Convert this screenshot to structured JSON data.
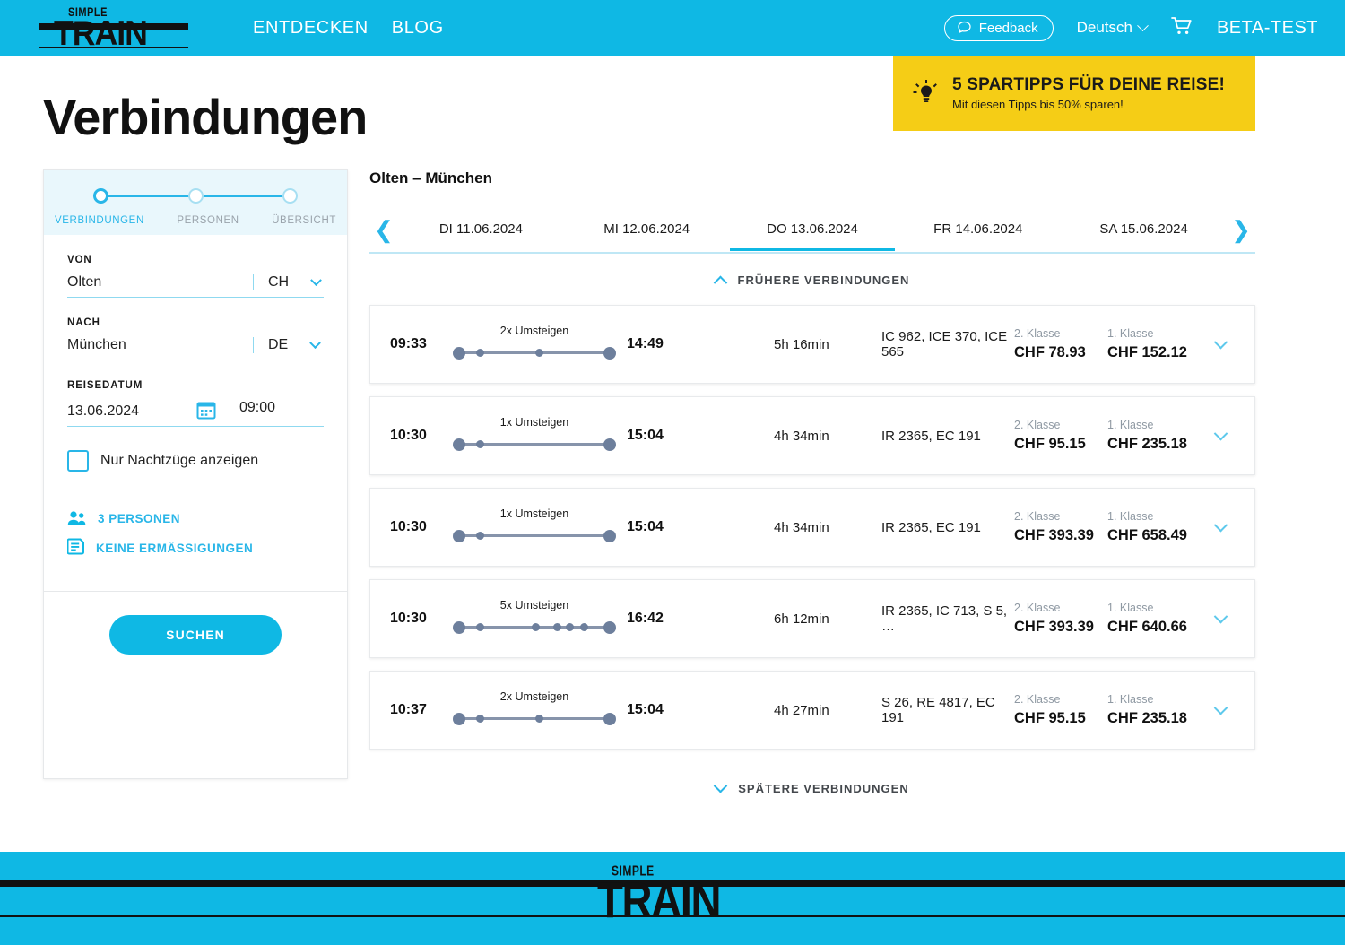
{
  "header": {
    "logo_top": "SIMPLE",
    "logo_main": "TRAIN",
    "nav": [
      {
        "label": "ENTDECKEN"
      },
      {
        "label": "BLOG"
      }
    ],
    "feedback_label": "Feedback",
    "language": "Deutsch",
    "beta_label": "BETA-TEST",
    "brand_color": "#0fb8e4"
  },
  "promo": {
    "title": "5 SPARTIPPS FÜR DEINE REISE!",
    "subtitle": "Mit diesen Tipps bis 50% sparen!",
    "background": "#f5cd16"
  },
  "page_title": "Verbindungen",
  "sidebar": {
    "steps": [
      {
        "label": "VERBINDUNGEN",
        "state": "active"
      },
      {
        "label": "PERSONEN",
        "state": "pending"
      },
      {
        "label": "ÜBERSICHT",
        "state": "pending"
      }
    ],
    "from_label": "VON",
    "from_city": "Olten",
    "from_country": "CH",
    "to_label": "NACH",
    "to_city": "München",
    "to_country": "DE",
    "date_label": "REISEDATUM",
    "date_value": "13.06.2024",
    "time_value": "09:00",
    "night_trains_label": "Nur Nachtzüge anzeigen",
    "night_trains_checked": false,
    "persons_label": "3 PERSONEN",
    "discounts_label": "KEINE ERMÄSSIGUNGEN",
    "search_label": "SUCHEN"
  },
  "results": {
    "route_title": "Olten – München",
    "date_tabs": [
      {
        "label": "DI 11.06.2024",
        "active": false
      },
      {
        "label": "MI 12.06.2024",
        "active": false
      },
      {
        "label": "DO 13.06.2024",
        "active": true
      },
      {
        "label": "FR 14.06.2024",
        "active": false
      },
      {
        "label": "SA 15.06.2024",
        "active": false
      }
    ],
    "earlier_label": "FRÜHERE VERBINDUNGEN",
    "later_label": "SPÄTERE VERBINDUNGEN",
    "class2_label": "2. Klasse",
    "class1_label": "1. Klasse",
    "connections": [
      {
        "departure": "09:33",
        "arrival": "14:49",
        "changes_label": "2x Umsteigen",
        "changes": 2,
        "duration": "5h 16min",
        "trains": "IC 962, ICE 370, ICE 565",
        "price_class2": "CHF 78.93",
        "price_class1": "CHF 152.12"
      },
      {
        "departure": "10:30",
        "arrival": "15:04",
        "changes_label": "1x Umsteigen",
        "changes": 1,
        "duration": "4h 34min",
        "trains": "IR 2365, EC 191",
        "price_class2": "CHF 95.15",
        "price_class1": "CHF 235.18"
      },
      {
        "departure": "10:30",
        "arrival": "15:04",
        "changes_label": "1x Umsteigen",
        "changes": 1,
        "duration": "4h 34min",
        "trains": "IR 2365, EC 191",
        "price_class2": "CHF 393.39",
        "price_class1": "CHF 658.49"
      },
      {
        "departure": "10:30",
        "arrival": "16:42",
        "changes_label": "5x Umsteigen",
        "changes": 5,
        "duration": "6h 12min",
        "trains": "IR 2365, IC 713, S 5, …",
        "price_class2": "CHF 393.39",
        "price_class1": "CHF 640.66"
      },
      {
        "departure": "10:37",
        "arrival": "15:04",
        "changes_label": "2x Umsteigen",
        "changes": 2,
        "duration": "4h 27min",
        "trains": "S 26, RE 4817, EC 191",
        "price_class2": "CHF 95.15",
        "price_class1": "CHF 235.18"
      }
    ]
  },
  "footer": {
    "logo_top": "SIMPLE",
    "logo_main": "TRAIN"
  }
}
